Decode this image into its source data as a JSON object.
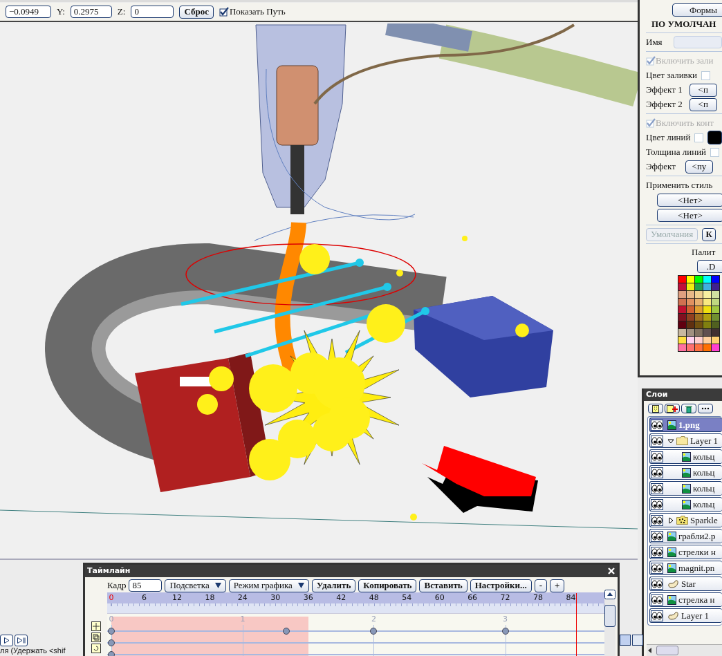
{
  "toolbar": {
    "x_value": "−0.0949",
    "y_label": "Y:",
    "y_value": "0.2975",
    "z_label": "Z:",
    "z_value": "0",
    "reset_button": "Сброс",
    "show_path": {
      "label": "Показать Путь",
      "checked": true
    }
  },
  "properties": {
    "shapes_button": "Формы",
    "heading": "ПО УМОЛЧАН",
    "name_label": "Имя",
    "fill_toggle": {
      "label": "Включить зали",
      "checked": true,
      "disabled": true
    },
    "fill_color": {
      "label": "Цвет заливки",
      "checked": false
    },
    "effects": [
      {
        "label": "Эффект 1",
        "value": "<п"
      },
      {
        "label": "Эффект 2",
        "value": "<п"
      }
    ],
    "stroke_toggle": {
      "label": "Включить конт",
      "checked": true,
      "disabled": true
    },
    "line_color": {
      "label": "Цвет линий",
      "checked": false
    },
    "line_width": {
      "label": "Толщина линий",
      "checked": false
    },
    "effect": {
      "label": "Эффект",
      "value": "<пу"
    },
    "apply_style_label": "Применить стиль",
    "style_buttons": [
      "<Нет>",
      "<Нет>"
    ],
    "defaults_button": {
      "label": "Умолчания",
      "disabled": true
    },
    "other_button": "К",
    "palette_label": "Палит",
    "palette_button": ".D",
    "palette": [
      {
        "swatches": [
          {
            "color": "#ff0000"
          },
          {
            "color": "#ffff00"
          },
          {
            "color": "#00ff00"
          },
          {
            "color": "#00ffff"
          },
          {
            "color": "#0000ff"
          }
        ]
      },
      {
        "swatches": [
          {
            "color": "#c0103a"
          },
          {
            "color": "#f0f010"
          },
          {
            "color": "#20a050"
          },
          {
            "color": "#40b0e0"
          },
          {
            "color": "#402090"
          }
        ]
      },
      {
        "swatches": [
          {
            "color": "#e0a080"
          },
          {
            "color": "#e8b888"
          },
          {
            "color": "#f0d090"
          },
          {
            "color": "#f8f0a0"
          },
          {
            "color": "#d0e0a0"
          }
        ]
      },
      {
        "swatches": [
          {
            "color": "#d07050"
          },
          {
            "color": "#e09060"
          },
          {
            "color": "#e8b070"
          },
          {
            "color": "#f8e880"
          },
          {
            "color": "#c0d880"
          }
        ]
      },
      {
        "swatches": [
          {
            "color": "#c01030"
          },
          {
            "color": "#d06030"
          },
          {
            "color": "#e0a030"
          },
          {
            "color": "#f0e010"
          },
          {
            "color": "#a0c840"
          }
        ]
      },
      {
        "swatches": [
          {
            "color": "#801020"
          },
          {
            "color": "#904020"
          },
          {
            "color": "#a07020"
          },
          {
            "color": "#b0a010"
          },
          {
            "color": "#709030"
          }
        ]
      },
      {
        "swatches": [
          {
            "color": "#600010"
          },
          {
            "color": "#603010"
          },
          {
            "color": "#705010"
          },
          {
            "color": "#808010"
          },
          {
            "color": "#506020"
          }
        ]
      },
      {
        "swatches": [
          {
            "color": "#c8b8a0"
          },
          {
            "color": "#a09080"
          },
          {
            "color": "#807060"
          },
          {
            "color": "#605050"
          },
          {
            "color": "#403030"
          }
        ]
      },
      {
        "swatches": [
          {
            "color": "#ffe040"
          },
          {
            "color": "#ffd0f0"
          },
          {
            "color": "#ffd0d0"
          },
          {
            "color": "#ffd0a0"
          },
          {
            "color": "#ffd070"
          }
        ]
      },
      {
        "swatches": [
          {
            "color": "#ff70a0"
          },
          {
            "color": "#ff7070"
          },
          {
            "color": "#ff7040"
          },
          {
            "color": "#ff7000"
          },
          {
            "color": "#ff40d0"
          }
        ]
      }
    ]
  },
  "layers": {
    "title": "Слои",
    "items": [
      {
        "kind": "image",
        "name": "1.png",
        "selected": true
      },
      {
        "kind": "folder",
        "name": "Layer 1",
        "selected": false,
        "expanded": true,
        "children": [
          {
            "kind": "image",
            "name": "кольц",
            "selected": false
          },
          {
            "kind": "image",
            "name": "кольц",
            "selected": false
          },
          {
            "kind": "image",
            "name": "кольц",
            "selected": false
          },
          {
            "kind": "image",
            "name": "кольц",
            "selected": false
          }
        ]
      },
      {
        "kind": "group",
        "name": "Sparkle",
        "selected": false,
        "expanded": false
      },
      {
        "kind": "image",
        "name": "грабли2.p",
        "selected": false
      },
      {
        "kind": "image",
        "name": "стрелки н",
        "selected": false
      },
      {
        "kind": "image",
        "name": "magnit.pn",
        "selected": false
      },
      {
        "kind": "shape",
        "name": "Star",
        "selected": false
      },
      {
        "kind": "image",
        "name": "стрелка н",
        "selected": false
      },
      {
        "kind": "shape",
        "name": "Layer 1",
        "selected": false
      }
    ]
  },
  "timeline": {
    "title": "Таймлайн",
    "frame_label": "Кадр",
    "frame_value": "85",
    "dropdowns": [
      "Подсветка",
      "Режим графика"
    ],
    "buttons": [
      "Удалить",
      "Копировать",
      "Вставить",
      "Настройки...",
      "-",
      "+"
    ],
    "ruler_labels": [
      "0",
      "6",
      "12",
      "18",
      "24",
      "30",
      "36",
      "42",
      "48",
      "54",
      "60",
      "66",
      "72",
      "78",
      "84"
    ],
    "cursor": {
      "level": 0.944
    },
    "highlight": {
      "level": 0.4
    },
    "keyframes": [
      {
        "label": "0",
        "level": 0
      },
      {
        "label": "1",
        "level": 0.267
      },
      {
        "label": "2",
        "level": 0.533
      },
      {
        "label": "3",
        "level": 0.8
      }
    ],
    "tracks": [
      {
        "waypoints": [
          {
            "level": 0
          },
          {
            "level": 0.356
          },
          {
            "level": 0.533
          },
          {
            "level": 0.8
          }
        ]
      },
      {
        "waypoints": [
          {
            "level": 0
          }
        ]
      },
      {
        "waypoints": [
          {
            "level": 0
          }
        ]
      }
    ]
  },
  "status_bar": {
    "text": "ля (Удержать <shif"
  }
}
